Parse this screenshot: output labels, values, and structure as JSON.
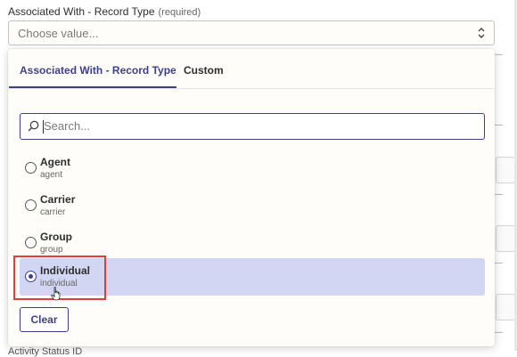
{
  "field": {
    "label": "Associated With - Record Type",
    "required": "(required)",
    "placeholder": "Choose value..."
  },
  "dropdown": {
    "tabs": [
      {
        "label": "Associated With - Record Type",
        "active": true
      },
      {
        "label": "Custom",
        "active": false
      }
    ],
    "search_placeholder": "Search...",
    "options": [
      {
        "label": "Agent",
        "value": "agent",
        "selected": false
      },
      {
        "label": "Carrier",
        "value": "carrier",
        "selected": false
      },
      {
        "label": "Group",
        "value": "group",
        "selected": false
      },
      {
        "label": "Individual",
        "value": "individual",
        "selected": true
      }
    ],
    "clear_label": "Clear"
  },
  "background": {
    "bottom_label": "Activity Status ID"
  },
  "colors": {
    "accent": "#3d3f8a",
    "selected_bg": "#d3d6f2",
    "highlight": "#e23c3c"
  }
}
